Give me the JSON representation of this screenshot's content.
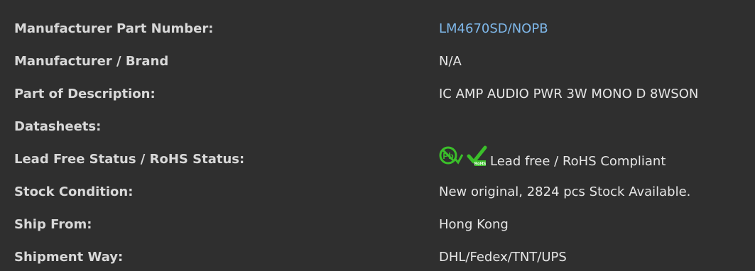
{
  "rows": [
    {
      "label": "Manufacturer Part Number:",
      "value": "LM4670SD/NOPB"
    },
    {
      "label": "Manufacturer / Brand",
      "value": "N/A"
    },
    {
      "label": "Part of Description:",
      "value": "IC AMP AUDIO PWR 3W MONO D 8WSON"
    },
    {
      "label": "Datasheets:",
      "value": ""
    },
    {
      "label": "Lead Free Status / RoHS Status:",
      "value": "Lead free / RoHS Compliant"
    },
    {
      "label": "Stock Condition:",
      "value": "New original, 2824 pcs Stock Available."
    },
    {
      "label": "Ship From:",
      "value": "Hong Kong"
    },
    {
      "label": "Shipment Way:",
      "value": "DHL/Fedex/TNT/UPS"
    }
  ],
  "icons": {
    "lead_free": "lead-free-icon",
    "rohs": "rohs-compliant-icon",
    "rohs_badge_text": "RoHS"
  },
  "colors": {
    "background": "#2f2f2f",
    "label": "#d8d8d8",
    "value": "#e6e6e6",
    "link": "#7fb8ea",
    "icon_green": "#3bbf2a"
  }
}
